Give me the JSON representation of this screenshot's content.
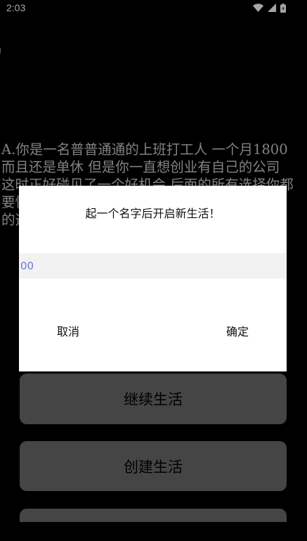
{
  "status_bar": {
    "time": "2:03",
    "icons": [
      "wifi-icon",
      "signal-icon",
      "battery-icon"
    ]
  },
  "story": {
    "text": "A.你是一名普普通通的上班打工人 一个月1800 而且还是单休 但是你一直想创业有自己的公司 这时正好碰见了一个好机会 后面的所有选择你都要慎重 一个错误的选择可能毁掉一切 请做出你的选择"
  },
  "menu": {
    "continue_label": "继续生活",
    "create_label": "创建生活"
  },
  "dialog": {
    "title": "起一个名字后开启新生活！",
    "input_value": "00",
    "cancel_label": "取消",
    "confirm_label": "确定"
  },
  "colors": {
    "background": "#000000",
    "story_text": "#c8c8c8",
    "menu_button": "#6a6a6a",
    "dialog_background": "#ffffff",
    "input_background": "#f2f2f2",
    "input_text": "#6b7bd6"
  }
}
